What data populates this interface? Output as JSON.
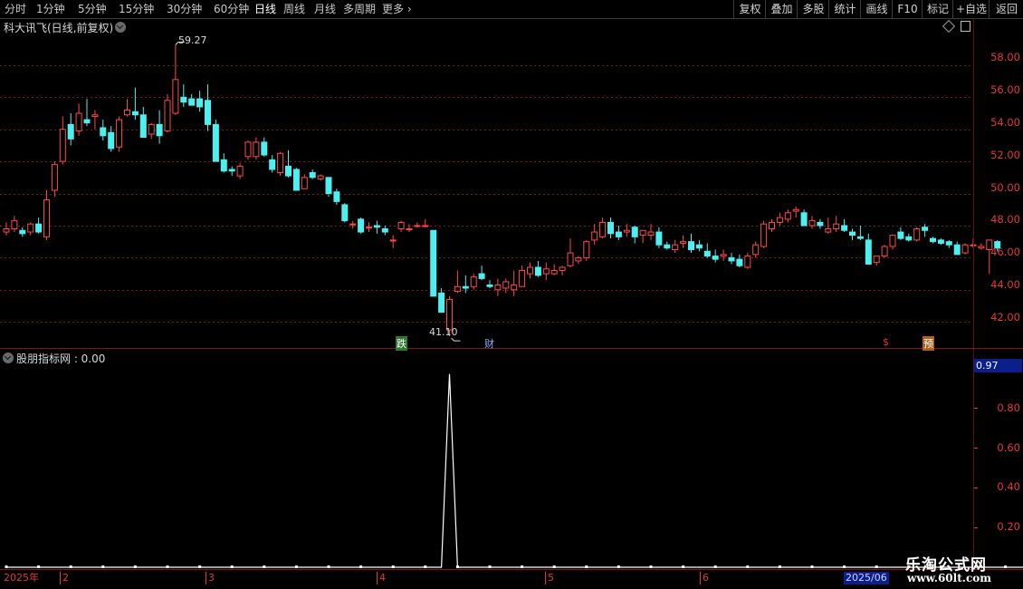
{
  "toolbar": {
    "left": [
      {
        "label": "分时"
      },
      {
        "label": "1分钟"
      },
      {
        "label": "5分钟"
      },
      {
        "label": "15分钟"
      },
      {
        "label": "30分钟"
      },
      {
        "label": "60分钟"
      },
      {
        "label": "日线"
      },
      {
        "label": "周线"
      },
      {
        "label": "月线"
      },
      {
        "label": "多周期"
      },
      {
        "label": "更多"
      }
    ],
    "right": [
      {
        "label": "复权"
      },
      {
        "label": "叠加"
      },
      {
        "label": "多股"
      },
      {
        "label": "统计"
      },
      {
        "label": "画线"
      },
      {
        "label": "F10"
      },
      {
        "label": "标记"
      },
      {
        "label": "+自选"
      },
      {
        "label": "返回"
      }
    ]
  },
  "main_panel": {
    "title": "科大讯飞(日线,前复权)",
    "max_label": "59.27",
    "min_label": "41.10",
    "event_markers": [
      {
        "text": "跌",
        "color": "#3aa63a"
      },
      {
        "text": "财",
        "color": "#3a6fd8"
      },
      {
        "text": "$",
        "color": "#e03a3a"
      },
      {
        "text": "预",
        "color": "#e08a2a"
      }
    ]
  },
  "indicator_panel": {
    "title": "股朋指标网 : 0.00",
    "current_value": "0.97"
  },
  "date_axis": {
    "start": "2025年",
    "months": [
      "2",
      "3",
      "4",
      "5",
      "6"
    ],
    "end": "2025/06"
  },
  "watermark": {
    "line1": "乐淘公式网",
    "line2": "www.60lt.com"
  },
  "colors": {
    "up": "#ff4a4a",
    "down": "#4cf0f0",
    "grid": "#7a1a1a",
    "axis": "#e03a3a"
  },
  "chart_data": [
    {
      "type": "candlestick",
      "title": "科大讯飞(日线,前复权)",
      "ylim": [
        40.6,
        59.8
      ],
      "yticks": [
        "42.00",
        "44.00",
        "46.00",
        "48.00",
        "50.00",
        "52.00",
        "54.00",
        "56.00",
        "58.00"
      ],
      "ohlc": [
        [
          47.6,
          48.2,
          47.4,
          47.8
        ],
        [
          47.8,
          48.6,
          47.6,
          48.3
        ],
        [
          47.7,
          47.9,
          47.3,
          47.5
        ],
        [
          47.6,
          48.2,
          47.4,
          48.1
        ],
        [
          48.1,
          48.5,
          47.5,
          47.6
        ],
        [
          47.3,
          50.2,
          47.1,
          49.6
        ],
        [
          50.2,
          52.0,
          49.8,
          51.8
        ],
        [
          52.0,
          54.8,
          51.8,
          54.0
        ],
        [
          54.3,
          55.0,
          53.0,
          53.4
        ],
        [
          53.9,
          55.6,
          53.6,
          55.0
        ],
        [
          54.6,
          55.9,
          54.2,
          54.4
        ],
        [
          54.8,
          55.2,
          54.0,
          54.9
        ],
        [
          54.1,
          54.6,
          53.3,
          53.6
        ],
        [
          53.8,
          54.2,
          52.6,
          52.8
        ],
        [
          52.9,
          54.8,
          52.6,
          54.6
        ],
        [
          54.9,
          55.9,
          54.8,
          55.2
        ],
        [
          55.1,
          56.6,
          54.6,
          54.9
        ],
        [
          54.9,
          55.4,
          53.5,
          53.5
        ],
        [
          53.7,
          54.4,
          53.4,
          54.3
        ],
        [
          54.3,
          55.2,
          53.1,
          53.6
        ],
        [
          53.9,
          56.2,
          53.8,
          55.8
        ],
        [
          55.0,
          59.27,
          54.9,
          57.1
        ],
        [
          56.0,
          56.8,
          55.4,
          55.7
        ],
        [
          55.9,
          56.2,
          55.5,
          55.5
        ],
        [
          55.9,
          56.4,
          55.1,
          55.4
        ],
        [
          55.8,
          56.8,
          53.9,
          54.3
        ],
        [
          54.3,
          54.6,
          52.0,
          52.0
        ],
        [
          52.1,
          52.5,
          51.3,
          51.4
        ],
        [
          51.5,
          51.7,
          51.1,
          51.4
        ],
        [
          51.1,
          51.9,
          50.9,
          51.7
        ],
        [
          52.3,
          53.3,
          52.1,
          53.2
        ],
        [
          52.3,
          53.5,
          52.1,
          53.2
        ],
        [
          53.2,
          53.5,
          52.3,
          52.4
        ],
        [
          52.1,
          52.4,
          51.3,
          51.5
        ],
        [
          51.3,
          52.6,
          51.1,
          52.5
        ],
        [
          51.7,
          52.7,
          51.0,
          51.1
        ],
        [
          51.5,
          51.6,
          50.2,
          50.2
        ],
        [
          50.3,
          51.2,
          50.3,
          51.0
        ],
        [
          51.3,
          51.5,
          50.9,
          51.0
        ],
        [
          50.9,
          51.2,
          50.8,
          51.1
        ],
        [
          51.0,
          51.0,
          49.8,
          50.0
        ],
        [
          50.1,
          50.3,
          49.3,
          49.5
        ],
        [
          49.3,
          49.4,
          48.2,
          48.3
        ],
        [
          48.1,
          48.3,
          47.8,
          48.1
        ],
        [
          48.4,
          48.5,
          47.5,
          47.6
        ],
        [
          47.9,
          48.2,
          47.6,
          47.9
        ],
        [
          48.0,
          48.3,
          47.5,
          47.9
        ],
        [
          47.8,
          48.0,
          47.4,
          47.6
        ],
        [
          47.1,
          47.4,
          46.6,
          47.1
        ],
        [
          47.8,
          48.3,
          47.6,
          48.2
        ],
        [
          47.8,
          48.1,
          47.6,
          47.8
        ],
        [
          48.0,
          48.2,
          47.9,
          48.0
        ],
        [
          48.0,
          48.4,
          47.9,
          48.0
        ],
        [
          47.7,
          45.8,
          43.6,
          43.6
        ],
        [
          43.8,
          44.1,
          42.6,
          42.6
        ],
        [
          41.5,
          43.6,
          41.1,
          43.4
        ],
        [
          43.9,
          45.2,
          43.8,
          44.2
        ],
        [
          44.2,
          44.9,
          43.8,
          44.1
        ],
        [
          44.2,
          45.0,
          44.0,
          44.8
        ],
        [
          45.0,
          45.5,
          44.6,
          44.7
        ],
        [
          44.3,
          44.6,
          44.1,
          44.2
        ],
        [
          44.0,
          44.7,
          43.6,
          44.3
        ],
        [
          44.1,
          44.7,
          43.8,
          44.5
        ],
        [
          44.0,
          45.2,
          43.6,
          44.3
        ],
        [
          44.2,
          45.5,
          44.2,
          45.2
        ],
        [
          45.0,
          45.7,
          44.7,
          45.4
        ],
        [
          45.4,
          45.8,
          44.8,
          44.9
        ],
        [
          45.0,
          45.7,
          44.6,
          45.3
        ],
        [
          45.0,
          45.6,
          44.9,
          45.2
        ],
        [
          45.2,
          45.5,
          44.9,
          45.4
        ],
        [
          45.5,
          47.2,
          45.4,
          46.3
        ],
        [
          45.8,
          46.1,
          45.6,
          46.0
        ],
        [
          46.0,
          47.1,
          45.8,
          47.0
        ],
        [
          47.1,
          48.1,
          46.8,
          47.6
        ],
        [
          47.3,
          48.5,
          47.2,
          48.2
        ],
        [
          48.2,
          48.5,
          47.2,
          47.5
        ],
        [
          47.6,
          48.0,
          47.1,
          47.3
        ],
        [
          47.6,
          48.1,
          47.3,
          47.7
        ],
        [
          47.9,
          48.0,
          46.9,
          47.3
        ],
        [
          47.4,
          47.7,
          46.9,
          47.7
        ],
        [
          47.4,
          48.1,
          47.1,
          47.6
        ],
        [
          47.6,
          47.9,
          46.6,
          46.8
        ],
        [
          46.8,
          47.0,
          46.5,
          46.6
        ],
        [
          46.5,
          47.1,
          46.3,
          46.8
        ],
        [
          46.9,
          47.4,
          46.6,
          47.0
        ],
        [
          47.0,
          47.5,
          46.3,
          46.5
        ],
        [
          46.8,
          47.1,
          46.4,
          46.6
        ],
        [
          46.4,
          46.9,
          46.0,
          46.1
        ],
        [
          46.1,
          46.5,
          45.7,
          45.9
        ],
        [
          46.1,
          46.5,
          45.8,
          46.2
        ],
        [
          46.0,
          46.3,
          45.6,
          45.8
        ],
        [
          45.9,
          46.2,
          45.4,
          45.5
        ],
        [
          45.4,
          46.3,
          45.3,
          46.1
        ],
        [
          46.2,
          47.0,
          46.0,
          46.8
        ],
        [
          46.7,
          48.3,
          46.6,
          48.1
        ],
        [
          47.8,
          48.4,
          47.6,
          48.2
        ],
        [
          48.2,
          48.8,
          48.0,
          48.5
        ],
        [
          48.4,
          49.0,
          48.2,
          48.8
        ],
        [
          48.9,
          49.2,
          48.5,
          49.0
        ],
        [
          48.8,
          49.0,
          48.0,
          48.0
        ],
        [
          48.0,
          48.6,
          47.8,
          48.3
        ],
        [
          48.2,
          48.4,
          47.8,
          48.0
        ],
        [
          47.6,
          48.5,
          47.5,
          47.8
        ],
        [
          47.8,
          48.6,
          47.6,
          48.1
        ],
        [
          48.0,
          48.4,
          47.6,
          47.7
        ],
        [
          47.6,
          47.8,
          47.1,
          47.4
        ],
        [
          47.3,
          48.0,
          47.1,
          47.2
        ],
        [
          47.1,
          47.5,
          45.6,
          45.6
        ],
        [
          45.7,
          46.0,
          45.5,
          46.1
        ],
        [
          46.1,
          46.8,
          46.0,
          46.7
        ],
        [
          46.7,
          47.4,
          46.5,
          47.4
        ],
        [
          47.6,
          47.9,
          47.1,
          47.2
        ],
        [
          47.3,
          47.5,
          47.0,
          47.1
        ],
        [
          47.1,
          47.9,
          47.0,
          47.8
        ],
        [
          47.9,
          48.1,
          47.3,
          47.7
        ],
        [
          47.2,
          47.3,
          46.9,
          47.0
        ],
        [
          47.1,
          47.2,
          46.8,
          46.9
        ],
        [
          47.0,
          47.1,
          46.6,
          46.8
        ],
        [
          46.8,
          47.0,
          46.2,
          46.2
        ],
        [
          46.3,
          46.9,
          46.2,
          46.8
        ],
        [
          46.8,
          47.2,
          46.6,
          46.8
        ],
        [
          46.6,
          46.9,
          46.5,
          46.7
        ],
        [
          46.5,
          46.9,
          45.0,
          47.1
        ],
        [
          47.0,
          47.1,
          46.4,
          46.6
        ]
      ]
    },
    {
      "type": "line",
      "title": "股朋指标网 : 0.00",
      "ylim": [
        0,
        1.0
      ],
      "yticks": [
        "0.20",
        "0.40",
        "0.60",
        "0.80"
      ],
      "current": "0.97",
      "values_note": "0 everywhere except spike at index 55",
      "spike_index": 55,
      "spike_value": 0.97,
      "count": 137
    }
  ]
}
